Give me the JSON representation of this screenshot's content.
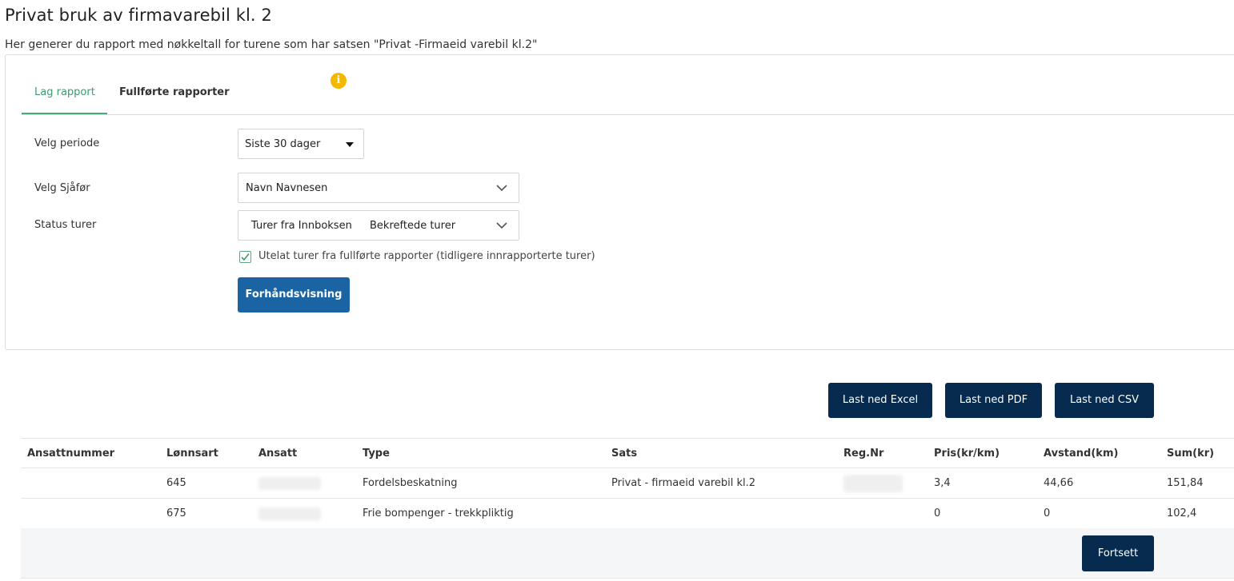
{
  "page": {
    "title": "Privat bruk av firmavarebil kl. 2",
    "subtitle": "Her generer du rapport med nøkkeltall for turene som har satsen \"Privat -Firmaeid varebil kl.2\""
  },
  "tabs": [
    {
      "label": "Lag rapport",
      "active": true
    },
    {
      "label": "Fullførte rapporter",
      "active": false
    }
  ],
  "info_icon": {
    "icon": "info-icon",
    "color": "#f5b800"
  },
  "form": {
    "period": {
      "label": "Velg periode",
      "value": "Siste 30 dager"
    },
    "driver": {
      "label": "Velg Sjåfør",
      "value": "Navn Navnesen"
    },
    "status": {
      "label": "Status turer",
      "values": [
        "Turer fra Innboksen",
        "Bekreftede turer"
      ]
    },
    "exclude_checkbox": {
      "label": "Utelat turer fra fullførte rapporter (tidligere innrapporterte turer)",
      "checked": true
    },
    "preview_button": "Forhåndsvisning"
  },
  "downloads": {
    "excel": "Last ned Excel",
    "pdf": "Last ned PDF",
    "csv": "Last ned CSV"
  },
  "table": {
    "headers": [
      "Ansattnummer",
      "Lønnsart",
      "Ansatt",
      "Type",
      "Sats",
      "Reg.Nr",
      "Pris(kr/km)",
      "Avstand(km)",
      "Sum(kr)"
    ],
    "rows": [
      {
        "ansattnummer": "",
        "lonnsart": "645",
        "type": "Fordelsbeskatning",
        "sats": "Privat - firmaeid varebil kl.2",
        "pris": "3,4",
        "avstand": "44,66",
        "sum": "151,84"
      },
      {
        "ansattnummer": "",
        "lonnsart": "675",
        "type": "Frie bompenger - trekkpliktig",
        "sats": "",
        "pris": "0",
        "avstand": "0",
        "sum": "102,4"
      }
    ]
  },
  "continue_button": "Fortsett",
  "colors": {
    "accent_green": "#3f9a70",
    "primary_blue": "#1b64a3",
    "dark_navy": "#062b4f"
  }
}
